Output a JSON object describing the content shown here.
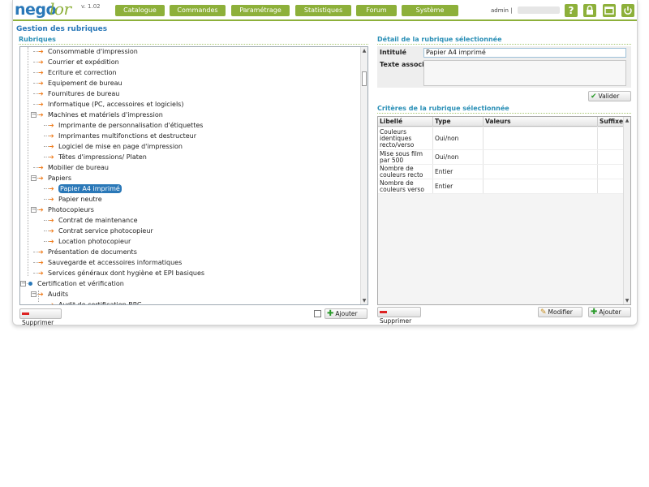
{
  "app": {
    "logo_part1": "nego",
    "logo_part2": "lor",
    "version": "v. 1.02"
  },
  "nav": [
    {
      "label": "Catalogue"
    },
    {
      "label": "Commandes"
    },
    {
      "label": "Paramétrage"
    },
    {
      "label": "Statistiques"
    },
    {
      "label": "Forum"
    },
    {
      "label": "Système"
    }
  ],
  "user": {
    "name": "admin |"
  },
  "toolbar_icons": [
    "help-icon",
    "lock-icon",
    "window-icon",
    "power-icon"
  ],
  "page_title": "Gestion des rubriques",
  "rubriques": {
    "title": "Rubriques",
    "items": [
      {
        "label": "Consommable d'impression"
      },
      {
        "label": "Courrier et expédition"
      },
      {
        "label": "Ecriture et correction"
      },
      {
        "label": "Equipement de bureau"
      },
      {
        "label": "Fournitures de bureau"
      },
      {
        "label": "Informatique (PC, accessoires et logiciels)"
      },
      {
        "label": "Machines et matériels d'impression",
        "expanded": true
      },
      {
        "label": "Imprimante de personnalisation d'étiquettes"
      },
      {
        "label": "Imprimantes multifonctions et destructeur"
      },
      {
        "label": "Logiciel de mise en page d'impression"
      },
      {
        "label": "Têtes d'impressions/ Platen"
      },
      {
        "label": "Mobilier de bureau"
      },
      {
        "label": "Papiers",
        "expanded": true
      },
      {
        "label": "Papier A4 imprimé",
        "selected": true
      },
      {
        "label": "Papier neutre"
      },
      {
        "label": "Photocopieurs",
        "expanded": true
      },
      {
        "label": "Contrat de maintenance"
      },
      {
        "label": "Contrat service photocopieur"
      },
      {
        "label": "Location photocopieur"
      },
      {
        "label": "Présentation de documents"
      },
      {
        "label": "Sauvegarde et accessoires informatiques"
      },
      {
        "label": "Services généraux dont hygiène et EPI basiques"
      },
      {
        "label": "Certification et vérification",
        "expanded": true
      },
      {
        "label": "Audits",
        "expanded": true
      },
      {
        "label": "Audit de certification BRC"
      }
    ],
    "delete_label": "Supprimer",
    "add_label": "Ajouter"
  },
  "detail": {
    "title": "Détail de la rubrique sélectionnée",
    "intitule_label": "Intitulé",
    "intitule_value": "Papier A4 imprimé",
    "texte_label": "Texte associé",
    "texte_value": "",
    "validate_label": "Valider"
  },
  "criteres": {
    "title": "Critères de la rubrique sélectionnée",
    "columns": [
      "Libellé",
      "Type",
      "Valeurs",
      "Suffixe"
    ],
    "rows": [
      {
        "libelle": "Couleurs identiques recto/verso",
        "type": "Oui/non",
        "valeurs": "",
        "suffixe": ""
      },
      {
        "libelle": "Mise sous film par 500",
        "type": "Oui/non",
        "valeurs": "",
        "suffixe": ""
      },
      {
        "libelle": "Nombre de couleurs recto",
        "type": "Entier",
        "valeurs": "",
        "suffixe": ""
      },
      {
        "libelle": "Nombre de couleurs verso",
        "type": "Entier",
        "valeurs": "",
        "suffixe": ""
      }
    ],
    "delete_label": "Supprimer",
    "modify_label": "Modifier",
    "add_label": "Ajouter"
  },
  "colors": {
    "accent_green": "#8db03a",
    "brand_blue": "#2a78b8",
    "arrow_orange": "#ee7d1e"
  }
}
